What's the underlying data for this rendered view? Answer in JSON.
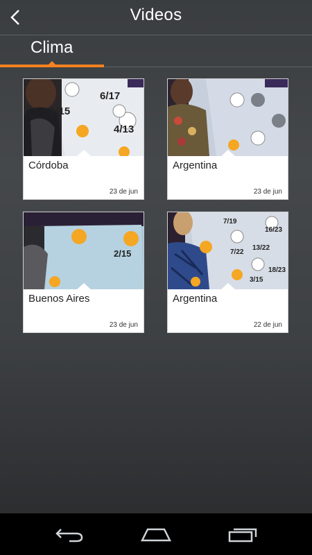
{
  "header": {
    "title": "Videos",
    "back_icon": "chevron-left-icon"
  },
  "tabs": [
    {
      "label": "Clima",
      "active": true
    }
  ],
  "accent_color": "#f58220",
  "videos": [
    {
      "title": "Córdoba",
      "date": "23 de jun",
      "map_labels": [
        "6/17",
        "1/15",
        "4/13"
      ]
    },
    {
      "title": "Argentina",
      "date": "23 de jun",
      "map_labels": []
    },
    {
      "title": "Buenos Aires",
      "date": "23 de jun",
      "map_labels": [
        "2/15"
      ]
    },
    {
      "title": "Argentina",
      "date": "22 de jun",
      "map_labels": [
        "7/19",
        "16/23",
        "7/22",
        "13/22",
        "3/15",
        "18/23"
      ]
    }
  ],
  "navbar": {
    "icons": [
      "back-icon",
      "home-icon",
      "recent-apps-icon"
    ]
  }
}
